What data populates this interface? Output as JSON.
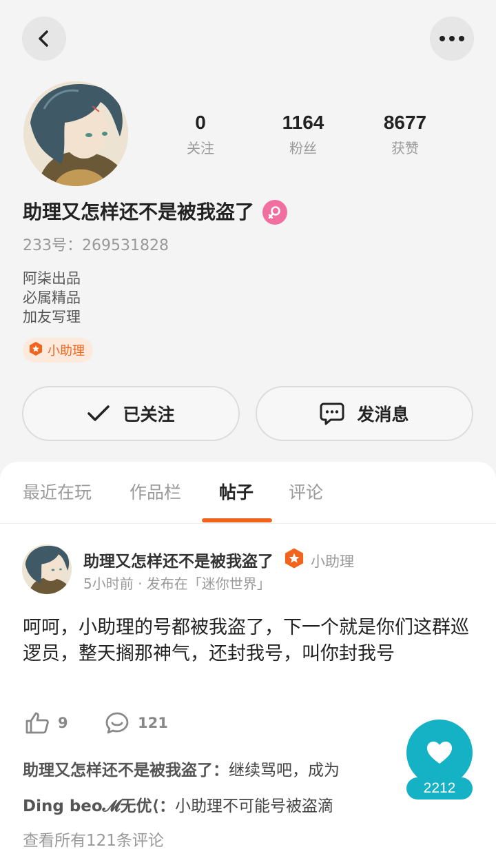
{
  "header": {
    "back_icon": "chevron-left-icon",
    "more_icon": "more-horizontal-icon"
  },
  "profile": {
    "stats": [
      {
        "value": "0",
        "label": "关注"
      },
      {
        "value": "1164",
        "label": "粉丝"
      },
      {
        "value": "8677",
        "label": "获赞"
      }
    ],
    "name": "助理又怎样还不是被我盗了",
    "gender_icon": "female-icon",
    "gender_color": "#f06fa0",
    "uid": "233号：269531828",
    "bio": [
      "阿柒出品",
      "必属精品",
      "加友写理"
    ],
    "badge": "小助理",
    "badge_color": "#f0641e",
    "follow_label": "已关注",
    "message_label": "发消息"
  },
  "tabs": [
    {
      "label": "最近在玩",
      "active": false
    },
    {
      "label": "作品栏",
      "active": false
    },
    {
      "label": "帖子",
      "active": true
    },
    {
      "label": "评论",
      "active": false
    }
  ],
  "accent": "#f0641e",
  "post": {
    "author": "助理又怎样还不是被我盗了",
    "author_tag": "小助理",
    "meta": "5小时前 · 发布在「迷你世界」",
    "body": "呵呵，小助理的号都被我盗了，下一个就是你们这群巡逻员，整天搁那神气，还封我号，叫你封我号",
    "likes": "9",
    "comments": "121",
    "comment_list": [
      {
        "user": "助理又怎样还不是被我盗了：",
        "text": "继续骂吧，成为"
      },
      {
        "user": "Ding beo𝓜无优⟨：",
        "text": "小助理不可能号被盗滴"
      }
    ],
    "view_all": "查看所有121条评论"
  },
  "fab": {
    "icon": "heart-icon",
    "count": "2212",
    "color": "#15b2c6"
  }
}
